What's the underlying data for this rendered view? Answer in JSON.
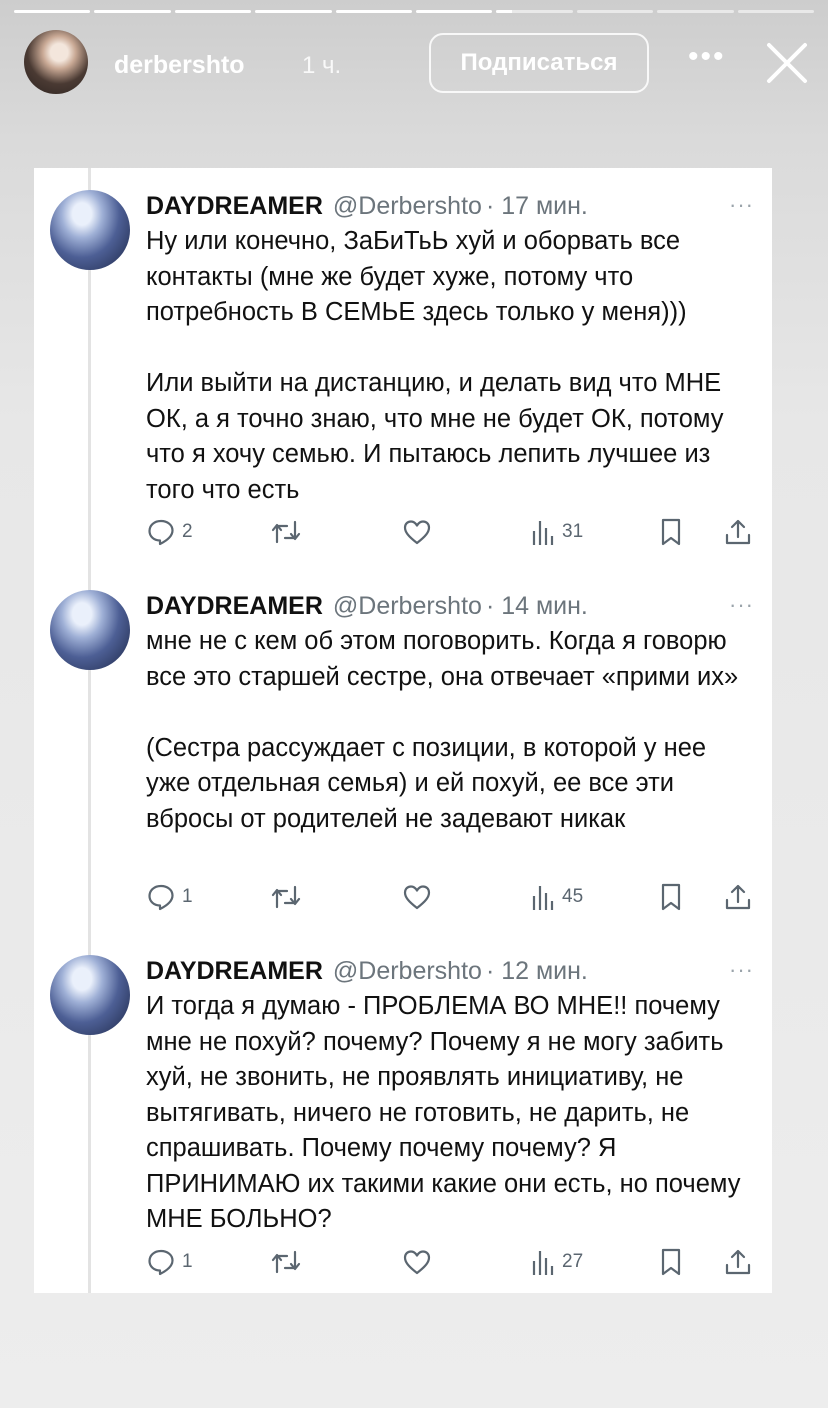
{
  "story": {
    "username": "derbershto",
    "time_ago": "1 ч.",
    "follow_label": "Подписаться",
    "more_label": "•••",
    "progress_segments": [
      1,
      1,
      1,
      1,
      1,
      1,
      0.2,
      0,
      0,
      0
    ]
  },
  "tweets": [
    {
      "name": "DAYDREAMER",
      "handle": "@Derbershto",
      "time": "· 17 мин.",
      "more": "···",
      "text": "Ну или конечно, ЗаБиТьЬ хуй и оборвать все контакты (мне же будет хуже, потому что потребность В СЕМЬЕ здесь только у меня)))\n\nИли выйти на дистанцию, и делать вид что МНЕ ОК, а я точно знаю, что мне не будет ОК, потому что я хочу семью. И пытаюсь лепить лучшее из того что есть",
      "replies": "2",
      "views": "31"
    },
    {
      "name": "DAYDREAMER",
      "handle": "@Derbershto",
      "time": "· 14 мин.",
      "more": "···",
      "text": "мне не с кем об этом поговорить. Когда я говорю все это старшей сестре, она отвечает «прими их»\n\n(Сестра рассуждает с позиции, в которой у нее уже отдельная семья) и ей похуй, ее все эти вбросы от родителей не задевают никак",
      "replies": "1",
      "views": "45"
    },
    {
      "name": "DAYDREAMER",
      "handle": "@Derbershto",
      "time": "· 12 мин.",
      "more": "···",
      "text": "И тогда я думаю - ПРОБЛЕМА ВО МНЕ!! почему мне не похуй? почему? Почему я не могу забить хуй, не звонить, не проявлять инициативу, не вытягивать, ничего не готовить, не дарить, не спрашивать. Почему почему почему? Я ПРИНИМАЮ их такими какие они есть, но почему МНЕ БОЛЬНО?",
      "replies": "1",
      "views": "27"
    }
  ]
}
